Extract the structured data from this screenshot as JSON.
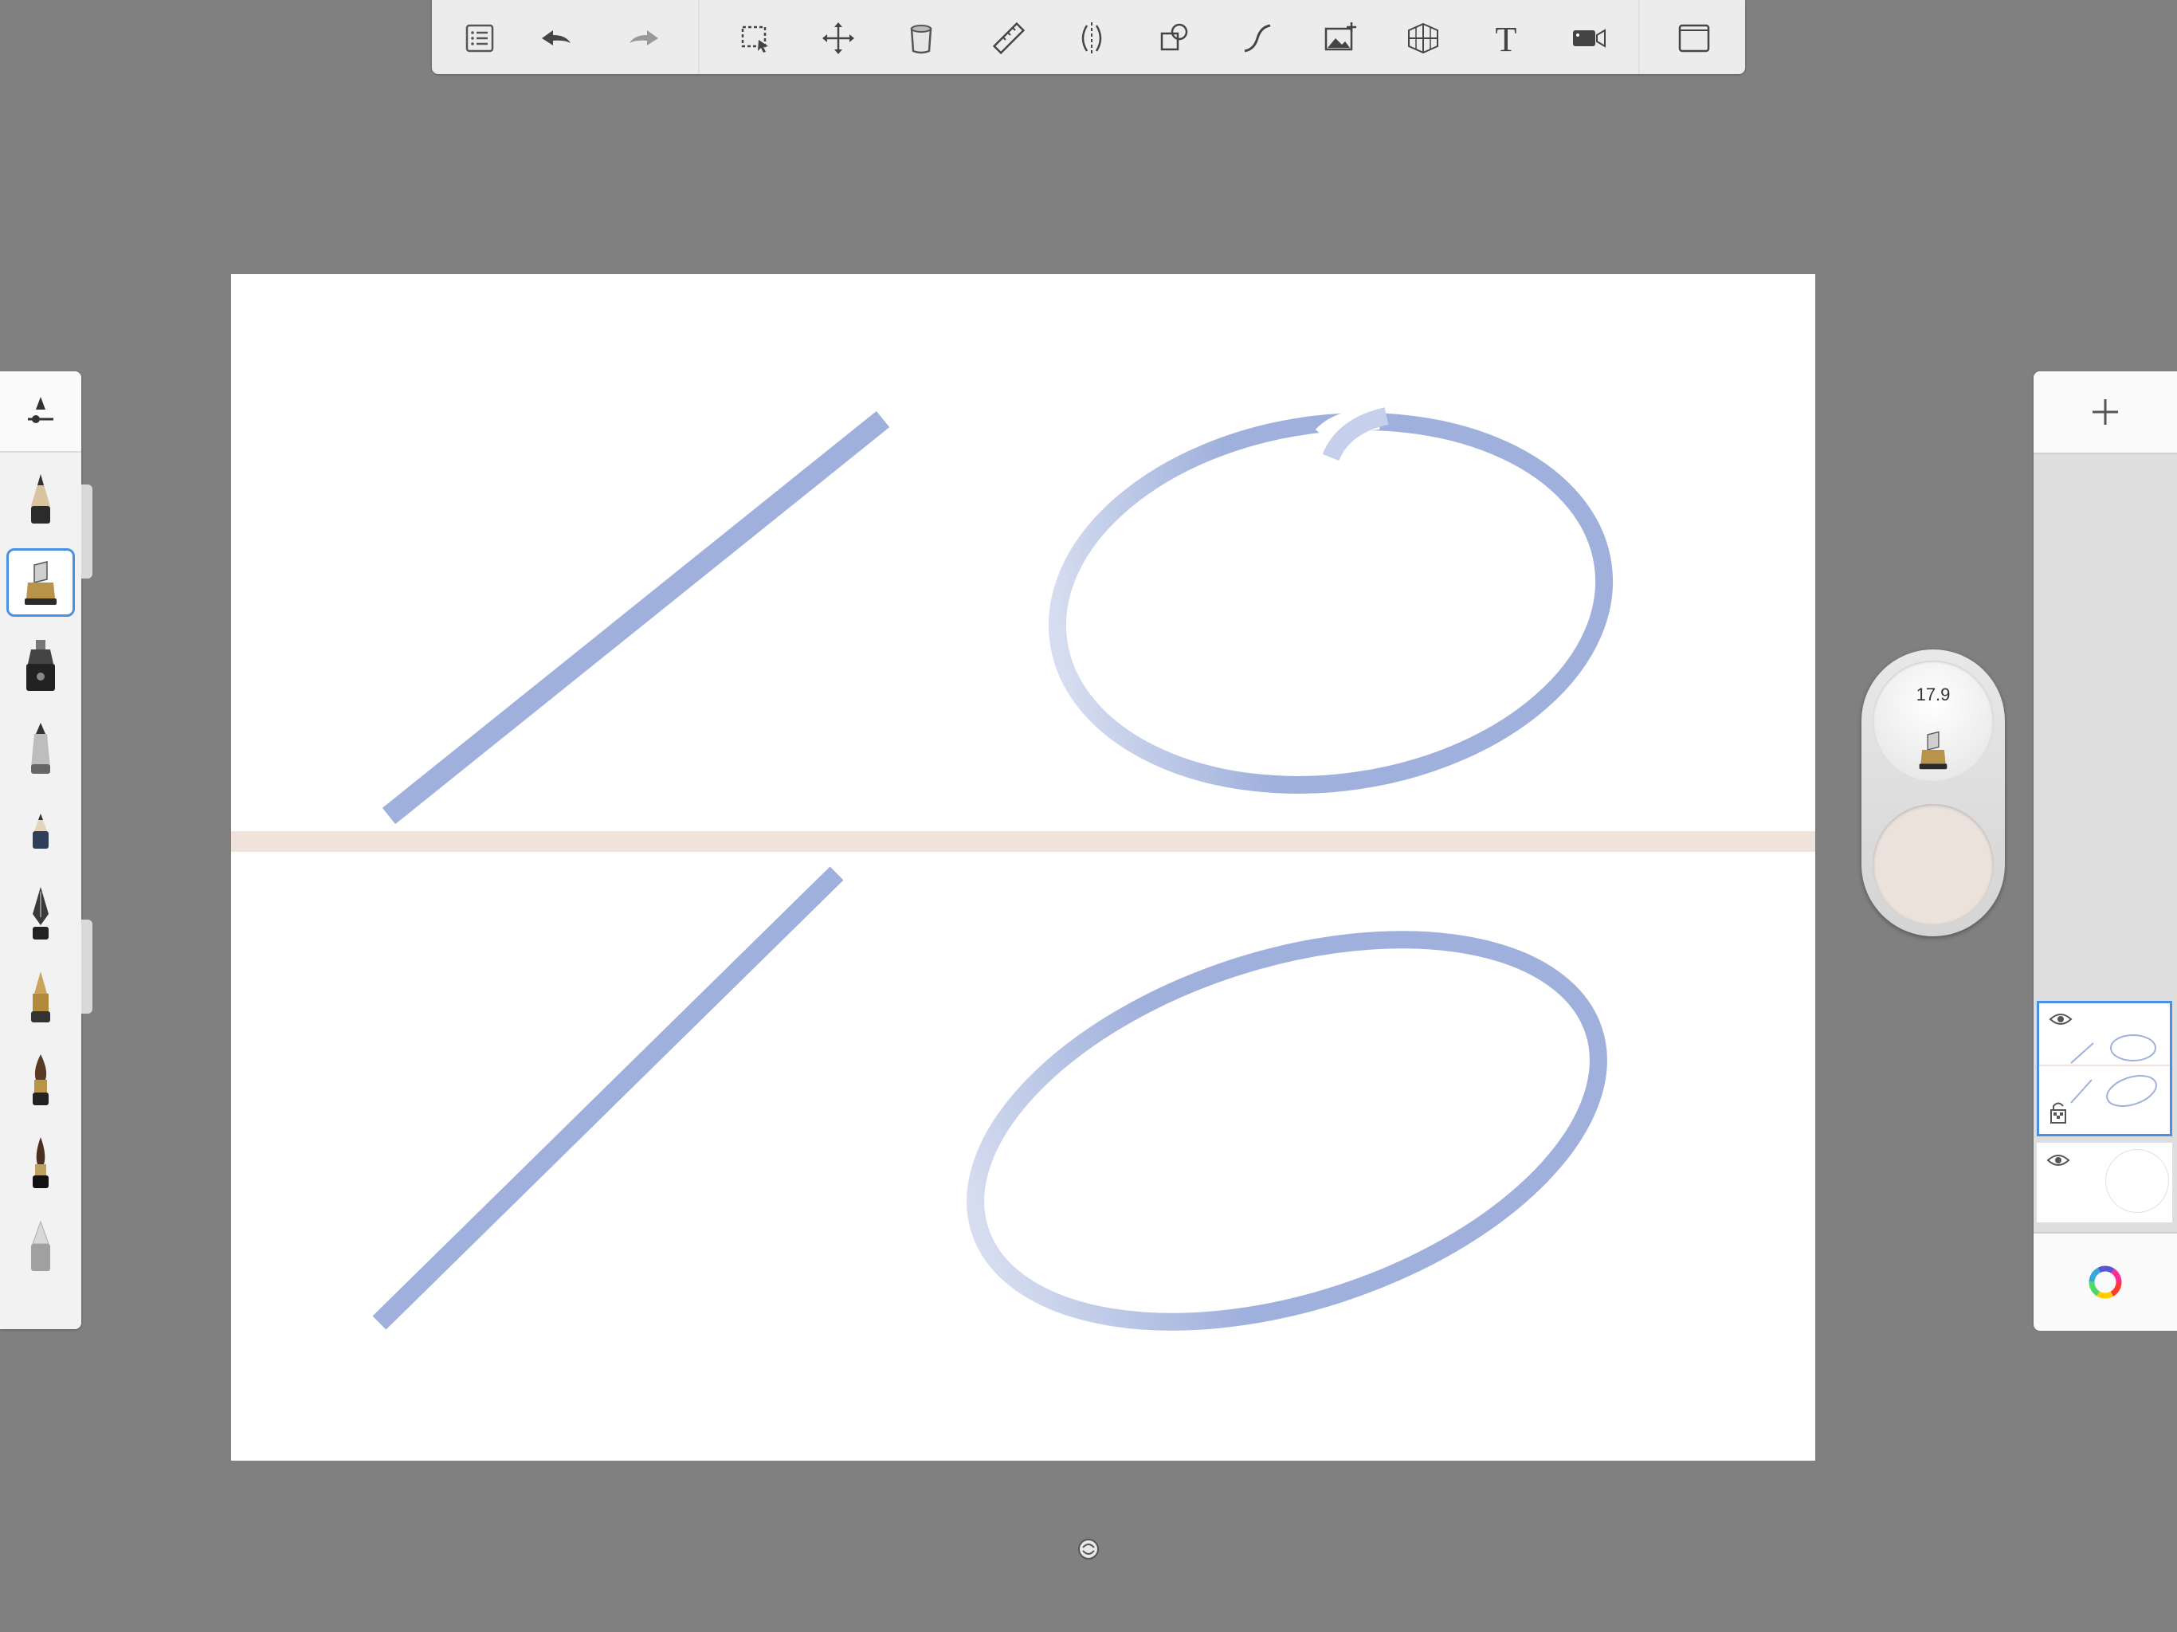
{
  "toolbar": {
    "tools": [
      "list-icon",
      "undo-icon",
      "redo-icon",
      "selection-icon",
      "transform-icon",
      "fill-bucket-icon",
      "ruler-icon",
      "symmetry-icon",
      "shapes-icon",
      "stroke-tool-icon",
      "import-image-icon",
      "perspective-icon",
      "text-icon",
      "time-lapse-icon",
      "fullscreen-icon"
    ]
  },
  "brush_library": {
    "items": [
      "pencil",
      "marker",
      "airbrush",
      "ballpoint",
      "soft-pencil",
      "ink-pen",
      "fountain-pen",
      "paint-brush",
      "fine-brush",
      "smudge"
    ],
    "selected": "marker"
  },
  "puck": {
    "brush_size": "17.9",
    "color": "#ece2dc"
  },
  "layers": {
    "count": 2,
    "active_index": 0
  },
  "colors": {
    "stroke": "#9fb0dc",
    "guide": "#efe3dc",
    "accent": "#4a90e2"
  }
}
